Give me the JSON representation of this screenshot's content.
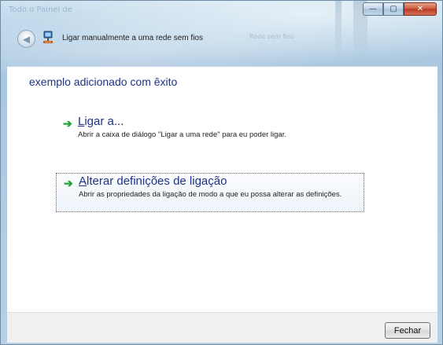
{
  "window": {
    "title": "Ligar manualmente a uma rede sem fios",
    "caption_buttons": {
      "minimize": "—",
      "maximize": "▢",
      "close": "✕"
    }
  },
  "background_text": {
    "top_left": "Todo o Painel de",
    "mid_right": "Rede sem fios"
  },
  "icons": {
    "back": "back-arrow-icon",
    "network": "network-icon",
    "command_arrow": "green-arrow-icon"
  },
  "content": {
    "heading": "exemplo adicionado com êxito",
    "commands": [
      {
        "title_first": "L",
        "title_rest": "igar a...",
        "description": "Abrir a caixa de diálogo \"Ligar a uma rede\" para eu poder ligar."
      },
      {
        "title_first": "A",
        "title_rest": "lterar definições de ligação",
        "description": "Abrir as propriedades da ligação de modo a que eu possa alterar as definições."
      }
    ]
  },
  "footer": {
    "close_label": "Fechar"
  },
  "colors": {
    "link_blue": "#1e3287",
    "arrow_green": "#1fa33a",
    "frame_blue": "#b9d4e8"
  }
}
